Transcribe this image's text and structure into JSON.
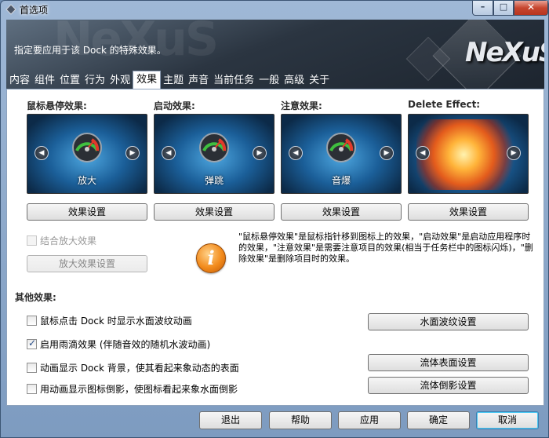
{
  "window": {
    "title": "首选项",
    "controls": {
      "minimize": "–",
      "maximize": "□",
      "close": "✕"
    }
  },
  "header": {
    "description": "指定要应用于该 Dock 的特殊效果。",
    "logo": "NeXuS"
  },
  "tabs": [
    {
      "label": "内容",
      "active": false
    },
    {
      "label": "组件",
      "active": false
    },
    {
      "label": "位置",
      "active": false
    },
    {
      "label": "行为",
      "active": false
    },
    {
      "label": "外观",
      "active": false
    },
    {
      "label": "效果",
      "active": true
    },
    {
      "label": "主题",
      "active": false
    },
    {
      "label": "声音",
      "active": false
    },
    {
      "label": "当前任务",
      "active": false
    },
    {
      "label": "一般",
      "active": false
    },
    {
      "label": "高级",
      "active": false
    },
    {
      "label": "关于",
      "active": false
    }
  ],
  "effects": [
    {
      "label": "鼠标悬停效果:",
      "preview_name": "放大",
      "button": "效果设置"
    },
    {
      "label": "启动效果:",
      "preview_name": "弹跳",
      "button": "效果设置"
    },
    {
      "label": "注意效果:",
      "preview_name": "音爆",
      "button": "效果设置"
    },
    {
      "label": "Delete Effect:",
      "preview_name": "",
      "button": "效果设置"
    }
  ],
  "zoom": {
    "checkbox_label": "结合放大效果",
    "checked": false,
    "button": "放大效果设置"
  },
  "info": {
    "text": "\"鼠标悬停效果\"是鼠标指针移到图标上的效果，\"启动效果\"是启动应用程序时的效果，\"注意效果\"是需要注意项目的效果(相当于任务栏中的图标闪烁)，\"删除效果\"是删除项目时的效果。"
  },
  "other": {
    "title": "其他效果:",
    "options": [
      {
        "label": "鼠标点击 Dock 时显示水面波纹动画",
        "checked": false
      },
      {
        "label": "启用雨滴效果 (伴随音效的随机水波动画)",
        "checked": true
      },
      {
        "label": "动画显示 Dock 背景，使其看起来象动态的表面",
        "checked": false
      },
      {
        "label": "用动画显示图标倒影，使图标看起来象水面倒影",
        "checked": false
      }
    ],
    "buttons": {
      "ripple": "水面波纹设置",
      "fluid_surface": "流体表面设置",
      "fluid_reflection": "流体倒影设置"
    }
  },
  "footer": {
    "exit": "退出",
    "help": "帮助",
    "apply": "应用",
    "ok": "确定",
    "cancel": "取消"
  }
}
